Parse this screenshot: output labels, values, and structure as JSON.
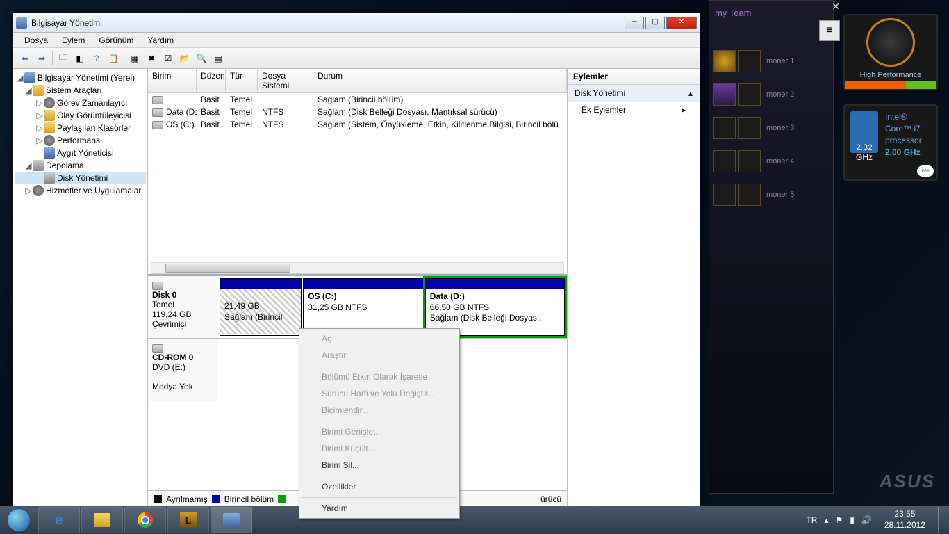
{
  "window": {
    "title": "Bilgisayar Yönetimi",
    "menu": {
      "file": "Dosya",
      "action": "Eylem",
      "view": "Görünüm",
      "help": "Yardım"
    }
  },
  "tree": {
    "root": "Bilgisayar Yönetimi (Yerel)",
    "sys_tools": "Sistem Araçları",
    "task_sched": "Görev Zamanlayıcı",
    "event_viewer": "Olay Görüntüleyicisi",
    "shared": "Paylaşılan Klasörler",
    "perf": "Performans",
    "devmgr": "Aygıt Yöneticisi",
    "storage": "Depolama",
    "diskmgmt": "Disk Yönetimi",
    "services": "Hizmetler ve Uygulamalar"
  },
  "vol_headers": {
    "volume": "Birim",
    "layout": "Düzen",
    "type": "Tür",
    "fs": "Dosya Sistemi",
    "status": "Durum"
  },
  "volumes": [
    {
      "name": "",
      "layout": "Basit",
      "type": "Temel",
      "fs": "",
      "status": "Sağlam (Birincil bölüm)"
    },
    {
      "name": "Data (D:)",
      "layout": "Basit",
      "type": "Temel",
      "fs": "NTFS",
      "status": "Sağlam (Disk Belleği Dosyası, Mantıksal sürücü)"
    },
    {
      "name": "OS (C:)",
      "layout": "Basit",
      "type": "Temel",
      "fs": "NTFS",
      "status": "Sağlam (Sistem, Önyükleme, Etkin, Kilitlenme Bilgisi, Birincil bölü"
    }
  ],
  "disk0": {
    "name": "Disk 0",
    "type": "Temel",
    "size": "119,24 GB",
    "state": "Çevrimiçi",
    "p1_size": "21,49 GB",
    "p1_status": "Sağlam (Birincil",
    "p2_name": "OS  (C:)",
    "p2_size": "31,25 GB NTFS",
    "p2_status": "",
    "p3_name": "Data  (D:)",
    "p3_size": "66,50 GB NTFS",
    "p3_status": "Sağlam (Disk Belleği Dosyası,"
  },
  "cdrom": {
    "name": "CD-ROM 0",
    "drive": "DVD (E:)",
    "state": "Medya Yok"
  },
  "legend": {
    "unalloc": "Ayrılmamış",
    "primary": "Birincil bölüm",
    "logical": "ürücü"
  },
  "actions": {
    "header": "Eylemler",
    "diskmgmt": "Disk Yönetimi",
    "more": "Ek Eylemler"
  },
  "ctx": {
    "open": "Aç",
    "explore": "Araştır",
    "mark_active": "Bölümü Etkin Olarak İşaretle",
    "change_letter": "Sürücü Harfi ve Yolu Değiştir...",
    "format": "Biçimlendir...",
    "extend": "Birimi Genişlet...",
    "shrink": "Birimi Küçült...",
    "delete": "Birim Sil...",
    "props": "Özellikler",
    "help": "Yardım"
  },
  "bg_app": {
    "title": "my Team",
    "s1": "moner 1",
    "s2": "moner 2",
    "s3": "moner 3",
    "s4": "moner 4",
    "s5": "moner 5"
  },
  "gadget_perf": {
    "label": "High Performance"
  },
  "gadget_cpu": {
    "ghz_cur": "2.32",
    "ghz_unit": "GHz",
    "brand": "Intel®",
    "model": "Core™ i7",
    "proc": "processor",
    "base": "2.00 GHz",
    "logo": "intel"
  },
  "asus": "ASUS",
  "tray": {
    "lang": "TR",
    "time": "23:55",
    "date": "28.11.2012"
  }
}
